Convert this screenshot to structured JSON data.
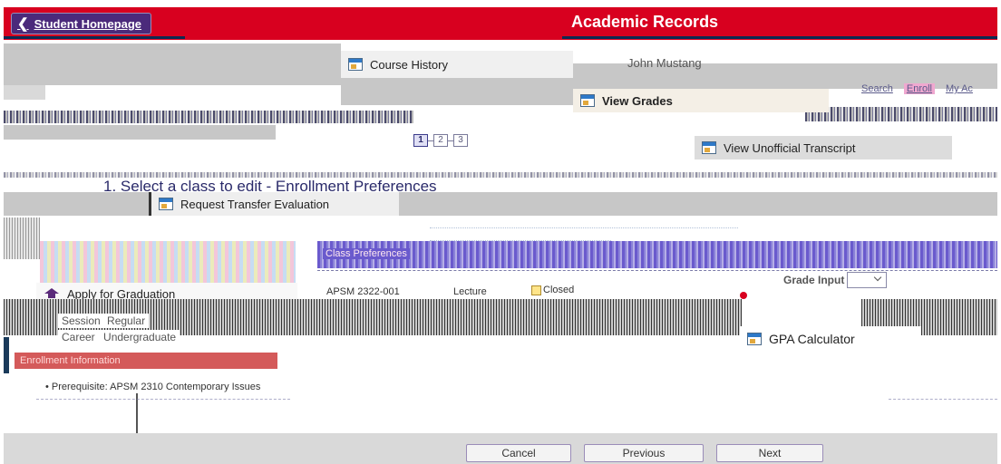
{
  "header": {
    "back_label": "Student Homepage",
    "title": "Academic Records"
  },
  "tiles": {
    "course_history": "Course History",
    "user_name": "John Mustang",
    "view_grades": "View Grades",
    "view_unofficial_transcript": "View Unofficial Transcript",
    "request_transfer_evaluation": "Request Transfer Evaluation",
    "apply_for_graduation": "Apply for Graduation",
    "gpa_calculator": "GPA Calculator"
  },
  "nav_links": {
    "search": "Search",
    "enroll": "Enroll",
    "my_academics": "My Ac"
  },
  "steps": [
    "1",
    "2",
    "3"
  ],
  "heading": "1.  Select a class to edit - Enrollment Preferences",
  "class_preferences_tab": "Class Preferences",
  "class_row": {
    "course_section": "APSM 2322-001",
    "component": "Lecture",
    "status": "Closed"
  },
  "grade_input": {
    "label": "Grade Input",
    "selected": ""
  },
  "details": {
    "session_label": "Session",
    "session_value": "Regular",
    "career_label": "Career",
    "career_value": "Undergraduate"
  },
  "enrollment_information": {
    "heading": "Enrollment Information",
    "prerequisite": "Prerequisite: APSM 2310 Contemporary Issues"
  },
  "buttons": {
    "cancel": "Cancel",
    "previous": "Previous",
    "next": "Next"
  },
  "colors": {
    "banner": "#d8001f",
    "back_button": "#4b2a7b",
    "enroll_bar": "#d45a5a",
    "class_pref_band": "#6a5acd"
  }
}
